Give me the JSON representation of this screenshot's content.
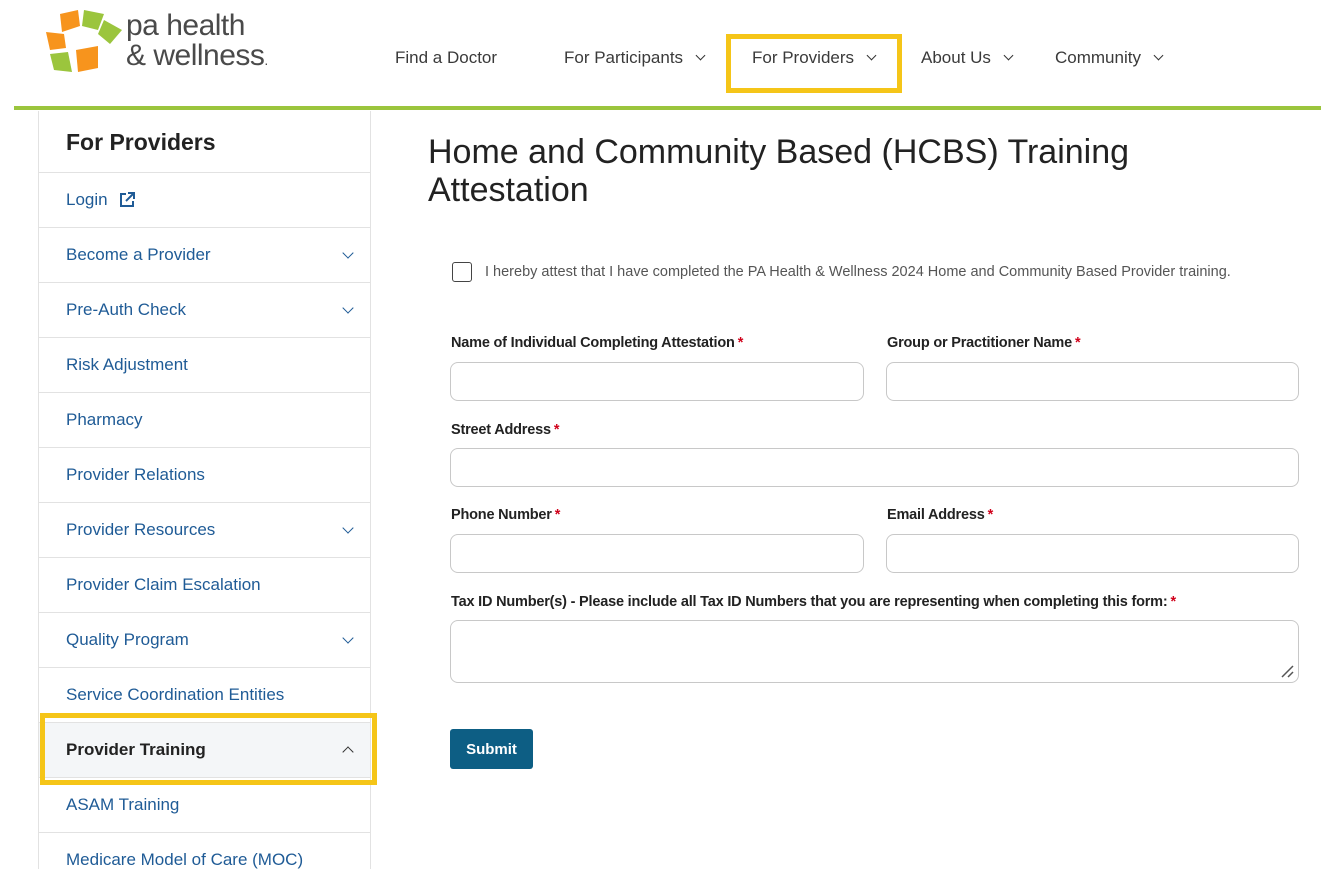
{
  "brand": {
    "line1": "pa health",
    "line2": "& wellness",
    "mark": "."
  },
  "nav": {
    "items": [
      {
        "label": "Find a Doctor"
      },
      {
        "label": "For Participants"
      },
      {
        "label": "For Providers"
      },
      {
        "label": "About Us"
      },
      {
        "label": "Community"
      }
    ]
  },
  "sidebar": {
    "title": "For Providers",
    "items": [
      {
        "label": "Login",
        "icon": "external-link-icon"
      },
      {
        "label": "Become a Provider",
        "expandable": true
      },
      {
        "label": "Pre-Auth Check",
        "expandable": true
      },
      {
        "label": "Risk Adjustment"
      },
      {
        "label": "Pharmacy"
      },
      {
        "label": "Provider Relations"
      },
      {
        "label": "Provider Resources",
        "expandable": true
      },
      {
        "label": "Provider Claim Escalation"
      },
      {
        "label": "Quality Program",
        "expandable": true
      },
      {
        "label": "Service Coordination Entities"
      },
      {
        "label": "Provider Training",
        "expanded": true,
        "active": true
      },
      {
        "label": "ASAM Training"
      },
      {
        "label": "Medicare Model of Care (MOC)"
      }
    ]
  },
  "main": {
    "title": "Home and Community Based (HCBS) Training Attestation",
    "attestation": "I hereby attest that I have completed the PA Health & Wellness 2024 Home and Community Based Provider training.",
    "required_mark": "*",
    "fields": {
      "name": {
        "label": "Name of Individual Completing Attestation",
        "value": ""
      },
      "group": {
        "label": "Group or Practitioner Name",
        "value": ""
      },
      "street": {
        "label": "Street Address",
        "value": ""
      },
      "phone": {
        "label": "Phone Number",
        "value": ""
      },
      "email": {
        "label": "Email Address",
        "value": ""
      },
      "taxid": {
        "label": "Tax ID Number(s) - Please include all Tax ID Numbers that you are representing when completing this form:",
        "value": ""
      }
    },
    "submit_label": "Submit"
  },
  "colors": {
    "accent_green": "#9bc53d",
    "highlight": "#f5c518",
    "link": "#1f5b96",
    "button": "#0d5e84",
    "required": "#d0021b"
  }
}
